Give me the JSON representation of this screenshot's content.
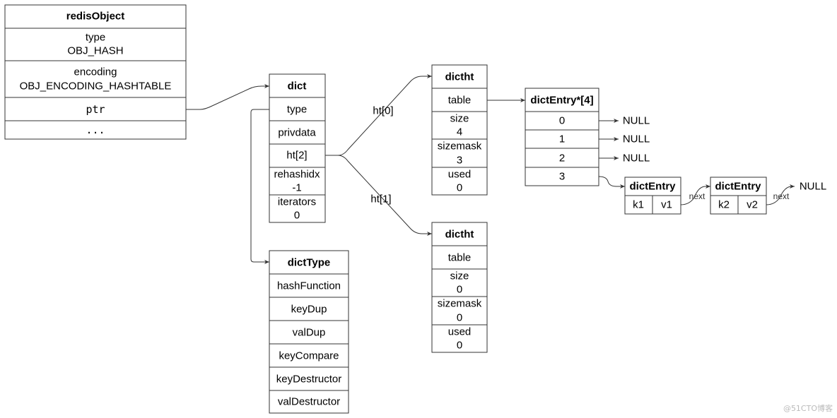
{
  "redisObject": {
    "title": "redisObject",
    "type_label": "type",
    "type_value": "OBJ_HASH",
    "encoding_label": "encoding",
    "encoding_value": "OBJ_ENCODING_HASHTABLE",
    "ptr": "ptr",
    "more": "..."
  },
  "dict": {
    "title": "dict",
    "type": "type",
    "privdata": "privdata",
    "ht": "ht[2]",
    "rehashidx_label": "rehashidx",
    "rehashidx_value": "-1",
    "iterators_label": "iterators",
    "iterators_value": "0"
  },
  "dictType": {
    "title": "dictType",
    "fields": [
      "hashFunction",
      "keyDup",
      "valDup",
      "keyCompare",
      "keyDestructor",
      "valDestructor"
    ]
  },
  "edges": {
    "ht0": "ht[0]",
    "ht1": "ht[1]",
    "next": "next"
  },
  "dictht0": {
    "title": "dictht",
    "table": "table",
    "size_label": "size",
    "size_value": "4",
    "sizemask_label": "sizemask",
    "sizemask_value": "3",
    "used_label": "used",
    "used_value": "0"
  },
  "dictht1": {
    "title": "dictht",
    "table": "table",
    "size_label": "size",
    "size_value": "0",
    "sizemask_label": "sizemask",
    "sizemask_value": "0",
    "used_label": "used",
    "used_value": "0"
  },
  "table": {
    "title": "dictEntry*[4]",
    "slots": [
      "0",
      "1",
      "2",
      "3"
    ],
    "null": "NULL"
  },
  "entries": [
    {
      "title": "dictEntry",
      "key": "k1",
      "value": "v1"
    },
    {
      "title": "dictEntry",
      "key": "k2",
      "value": "v2"
    }
  ],
  "watermark": "@51CTO博客"
}
